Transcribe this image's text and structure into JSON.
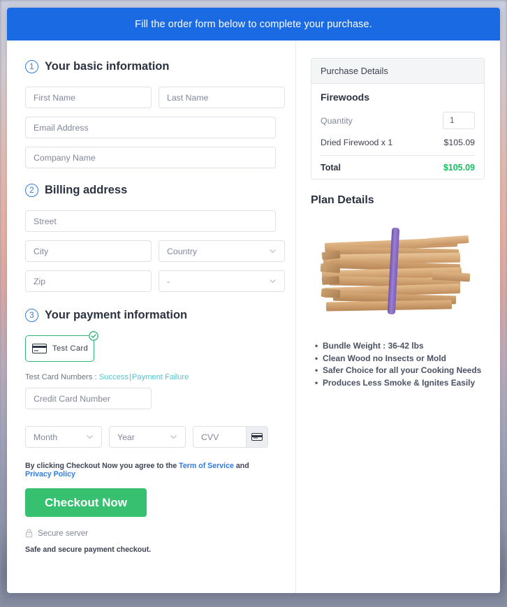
{
  "banner": {
    "text": "Fill the order form below to complete your purchase."
  },
  "form": {
    "sections": [
      {
        "step": "1",
        "title": "Your basic information"
      },
      {
        "step": "2",
        "title": "Billing address"
      },
      {
        "step": "3",
        "title": "Your payment information"
      }
    ],
    "basic": {
      "first_name_placeholder": "First Name",
      "last_name_placeholder": "Last Name",
      "email_placeholder": "Email Address",
      "company_placeholder": "Company Name"
    },
    "billing": {
      "street_placeholder": "Street",
      "city_placeholder": "City",
      "country_placeholder": "Country",
      "zip_placeholder": "Zip",
      "state_placeholder": "-"
    },
    "payment": {
      "tile_label": "Test  Card",
      "tile_selected": true,
      "test_card_prefix": "Test Card Numbers :",
      "test_card_success": "Success",
      "test_card_separator": "|",
      "test_card_failure": "Payment Failure",
      "credit_card_placeholder": "Credit Card Number",
      "month_placeholder": "Month",
      "year_placeholder": "Year",
      "cvv_placeholder": "CVV"
    },
    "terms": {
      "prefix": "By clicking Checkout Now you agree to the",
      "terms_link": "Term of Service",
      "conjunction": "and",
      "privacy_link": "Privacy Policy"
    },
    "checkout_button": "Checkout Now",
    "secure_server": "Secure server",
    "safe_note": "Safe and secure payment checkout."
  },
  "summary": {
    "purchase_header": "Purchase Details",
    "product_name": "Firewoods",
    "quantity_label": "Quantity",
    "quantity_value": "1",
    "line_item_label": "Dried Firewood x 1",
    "line_item_price": "$105.09",
    "total_label": "Total",
    "total_price": "$105.09",
    "plan_title": "Plan Details",
    "plan_image_alt": "bundle-of-firewood-photo",
    "plan_bullets": [
      "Bundle Weight : 36-42 lbs",
      "Clean Wood no Insects or Mold",
      "Safer Choice for all your Cooking Needs",
      "Produces Less Smoke & Ignites Easily"
    ]
  },
  "colors": {
    "banner_blue": "#1a6ae4",
    "step_blue": "#2f7ae5",
    "checkout_green": "#37c06f",
    "total_green": "#16bf5f",
    "tile_green": "#2cb673",
    "link_teal": "#4ec7d4"
  }
}
